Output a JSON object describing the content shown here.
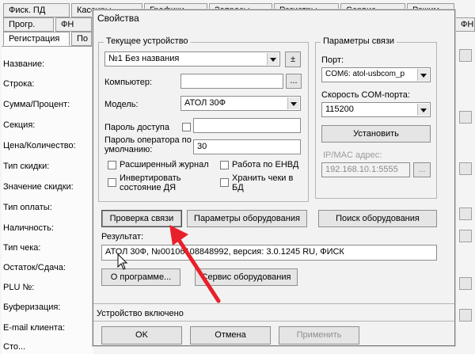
{
  "background_app": {
    "tabs_row1": [
      "Фиск. ПД",
      "Кассиры",
      "Графики",
      "Запросы",
      "Регистры",
      "Сервис",
      "Режим"
    ],
    "tabs_row2": [
      "Прогр.",
      "ФН",
      "",
      "ФН"
    ],
    "subtab_active": "Регистрация",
    "subtab_next": "По",
    "fields": [
      "Название:",
      "Строка:",
      "Сумма/Процент:",
      "Секция:",
      "Цена/Количество:",
      "Тип скидки:",
      "Значение скидки:",
      "Тип оплаты:",
      "Наличность:",
      "Тип чека:",
      "Остаток/Сдача:",
      "PLU №:",
      "Буферизация:",
      "E-mail клиента:",
      "Сто..."
    ]
  },
  "dialog": {
    "title": "Свойства",
    "current_device": {
      "group_title": "Текущее устройство",
      "device_value": "№1 Без названия",
      "plusminus_label": "±",
      "computer_label": "Компьютер:",
      "computer_value": "",
      "computer_browse": "...",
      "model_label": "Модель:",
      "model_value": "АТОЛ 30Ф",
      "access_password_label": "Пароль доступа",
      "operator_password_label": "Пароль оператора по умолчанию:",
      "operator_password_value": "30",
      "ext_journal_label": "Расширенный журнал",
      "envd_label": "Работа по ЕНВД",
      "invert_dya_label": "Инвертировать состояние ДЯ",
      "store_receipts_label": "Хранить чеки в БД"
    },
    "connection": {
      "group_title": "Параметры связи",
      "port_label": "Порт:",
      "port_value": "COM6: atol-usbcom_p",
      "speed_label": "Скорость COM-порта:",
      "speed_value": "115200",
      "install_label": "Установить",
      "ip_label": "IP/MAC адрес:",
      "ip_value": "192.168.10.1:5555",
      "ip_browse": "..."
    },
    "buttons": {
      "check": "Проверка связи",
      "hw_params": "Параметры оборудования",
      "search": "Поиск оборудования",
      "about": "О программе...",
      "service": "Сервис оборудования",
      "ok": "OK",
      "cancel": "Отмена",
      "apply": "Применить"
    },
    "result_label": "Результат:",
    "result_value": "АТОЛ 30Ф, №00106108848992, версия: 3.0.1245 RU, ФИСК",
    "status": "Устройство включено"
  },
  "colors": {
    "arrow": "#e8202a"
  }
}
